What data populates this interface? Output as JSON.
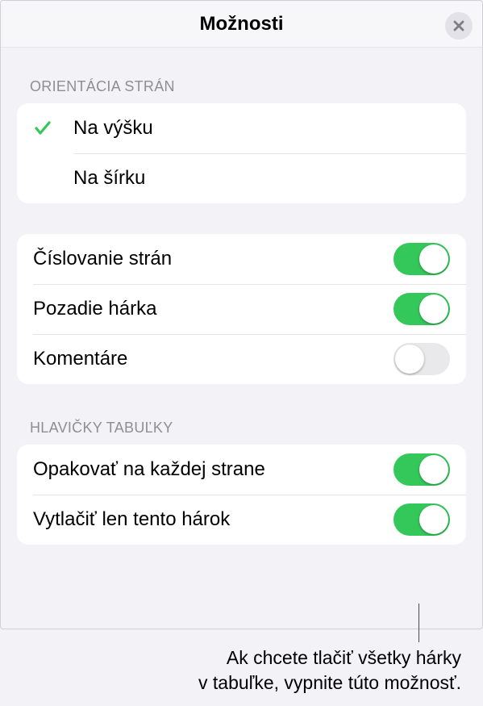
{
  "colors": {
    "accent": "#34c759",
    "toggleOff": "#e9e9eb",
    "panelBg": "#f2f2f7",
    "sectionHeader": "#8e8e93"
  },
  "header": {
    "title": "Možnosti"
  },
  "orientation": {
    "header": "Orientácia Strán",
    "options": [
      {
        "label": "Na výšku",
        "selected": true
      },
      {
        "label": "Na šírku",
        "selected": false
      }
    ]
  },
  "generalToggles": [
    {
      "label": "Číslovanie strán",
      "on": true
    },
    {
      "label": "Pozadie hárka",
      "on": true
    },
    {
      "label": "Komentáre",
      "on": false
    }
  ],
  "tableHeaders": {
    "header": "Hlavičky Tabuľky",
    "items": [
      {
        "label": "Opakovať na každej strane",
        "on": true
      },
      {
        "label": "Vytlačiť len tento hárok",
        "on": true
      }
    ]
  },
  "callout": {
    "line1": "Ak chcete tlačiť všetky hárky",
    "line2": "v tabuľke, vypnite túto možnosť."
  }
}
